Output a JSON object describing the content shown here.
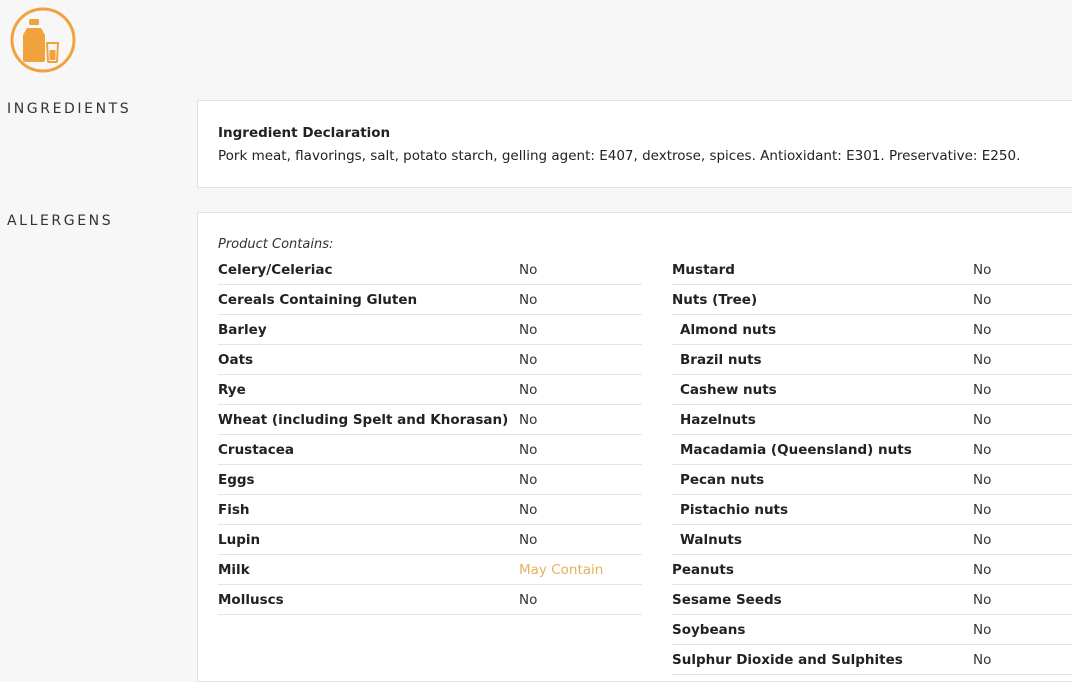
{
  "header": {
    "logo_icon": "milk-bottle-and-glass-icon",
    "accent_color": "#f0a33c"
  },
  "ingredients": {
    "section_label": "INGREDIENTS",
    "declaration_title": "Ingredient Declaration",
    "declaration_text": "Pork meat, flavorings, salt, potato starch, gelling agent: E407, dextrose, spices. Antioxidant: E301. Preservative: E250."
  },
  "allergens": {
    "section_label": "ALLERGENS",
    "contains_label": "Product Contains:",
    "warning_color": "#e8b15a",
    "left_column": [
      {
        "name": "Celery/Celeriac",
        "value": "No"
      },
      {
        "name": "Cereals Containing Gluten",
        "value": "No"
      },
      {
        "name": "Barley",
        "value": "No"
      },
      {
        "name": "Oats",
        "value": "No"
      },
      {
        "name": "Rye",
        "value": "No"
      },
      {
        "name": "Wheat (including Spelt and Khorasan)",
        "value": "No"
      },
      {
        "name": "Crustacea",
        "value": "No"
      },
      {
        "name": "Eggs",
        "value": "No"
      },
      {
        "name": "Fish",
        "value": "No"
      },
      {
        "name": "Lupin",
        "value": "No"
      },
      {
        "name": "Milk",
        "value": "May Contain",
        "warning": true
      },
      {
        "name": "Molluscs",
        "value": "No"
      }
    ],
    "right_column": [
      {
        "name": "Mustard",
        "value": "No"
      },
      {
        "name": "Nuts (Tree)",
        "value": "No"
      },
      {
        "name": "Almond nuts",
        "value": "No",
        "sub": true
      },
      {
        "name": "Brazil nuts",
        "value": "No",
        "sub": true
      },
      {
        "name": "Cashew nuts",
        "value": "No",
        "sub": true
      },
      {
        "name": "Hazelnuts",
        "value": "No",
        "sub": true
      },
      {
        "name": "Macadamia (Queensland) nuts",
        "value": "No",
        "sub": true
      },
      {
        "name": "Pecan nuts",
        "value": "No",
        "sub": true
      },
      {
        "name": "Pistachio nuts",
        "value": "No",
        "sub": true
      },
      {
        "name": "Walnuts",
        "value": "No",
        "sub": true
      },
      {
        "name": "Peanuts",
        "value": "No"
      },
      {
        "name": "Sesame Seeds",
        "value": "No"
      },
      {
        "name": "Soybeans",
        "value": "No"
      },
      {
        "name": "Sulphur Dioxide and Sulphites",
        "value": "No"
      }
    ]
  }
}
